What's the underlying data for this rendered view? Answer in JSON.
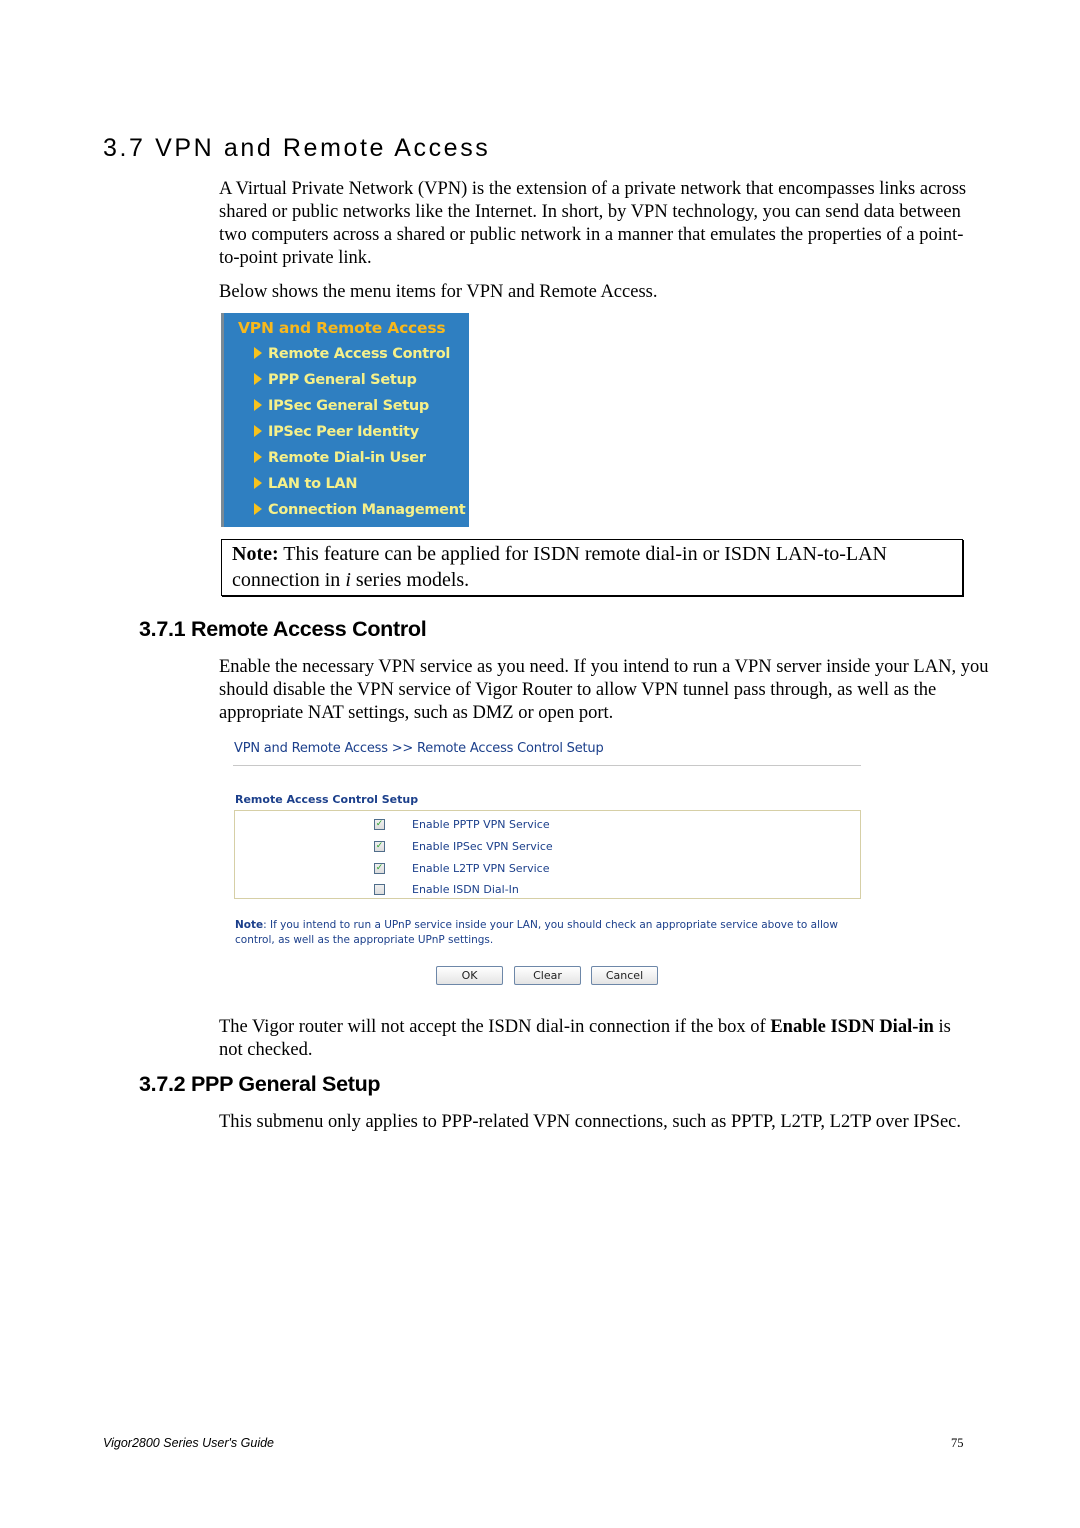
{
  "section": {
    "title": "3.7 VPN and Remote Access",
    "intro": "A Virtual Private Network (VPN) is the extension of a private network that encompasses links across shared or public networks like the Internet. In short, by VPN technology, you can send data between two computers across a shared or public network in a manner that emulates the properties of a point-to-point private link.",
    "menu_caption": "Below shows the menu items for VPN and Remote Access."
  },
  "menu": {
    "title": "VPN and Remote Access",
    "items": [
      {
        "label": "Remote Access Control"
      },
      {
        "label": "PPP General Setup"
      },
      {
        "label": "IPSec General Setup"
      },
      {
        "label": "IPSec Peer Identity"
      },
      {
        "label": "Remote Dial-in User"
      },
      {
        "label": "LAN to LAN"
      },
      {
        "label": "Connection Management"
      }
    ],
    "colors": {
      "background": "#2f7fc1",
      "title": "#f7b81d",
      "item": "#f5f08a"
    }
  },
  "note": {
    "label": "Note:",
    "text_before": " This feature can be applied for ISDN remote dial-in or ISDN LAN-to-LAN connection in ",
    "italic": "i",
    "text_after": " series models."
  },
  "subsection1": {
    "title": "3.7.1 Remote Access Control",
    "text": "Enable the necessary VPN service as you need. If you intend to run a VPN server inside your LAN, you should disable the VPN service of Vigor Router to allow VPN tunnel pass through, as well as the appropriate NAT settings, such as DMZ or open port.",
    "after_text_before": "The Vigor router will not accept the ISDN dial-in connection if the box of ",
    "after_text_bold": "Enable ISDN Dial-in",
    "after_text_after": " is not checked."
  },
  "screenshot": {
    "breadcrumb": "VPN and Remote Access >> Remote Access Control Setup",
    "section_title": "Remote Access Control Setup",
    "options": [
      {
        "label": "Enable PPTP VPN Service",
        "checked": true
      },
      {
        "label": "Enable IPSec VPN Service",
        "checked": true
      },
      {
        "label": "Enable L2TP VPN Service",
        "checked": true
      },
      {
        "label": "Enable ISDN Dial-In",
        "checked": false
      }
    ],
    "note_label": "Note",
    "note_text": ": If you intend to run a UPnP service inside your LAN, you should check an appropriate service above to allow control, as well as the appropriate UPnP settings.",
    "buttons": {
      "ok": "OK",
      "clear": "Clear",
      "cancel": "Cancel"
    },
    "colors": {
      "text": "#1b3f8b",
      "check": "#2aa02a"
    }
  },
  "subsection2": {
    "title": "3.7.2 PPP General Setup",
    "text": "This submenu only applies to PPP-related VPN connections, such as PPTP, L2TP, L2TP over IPSec."
  },
  "footer": {
    "guide_title": "Vigor2800 Series User's Guide",
    "page_number": "75"
  }
}
